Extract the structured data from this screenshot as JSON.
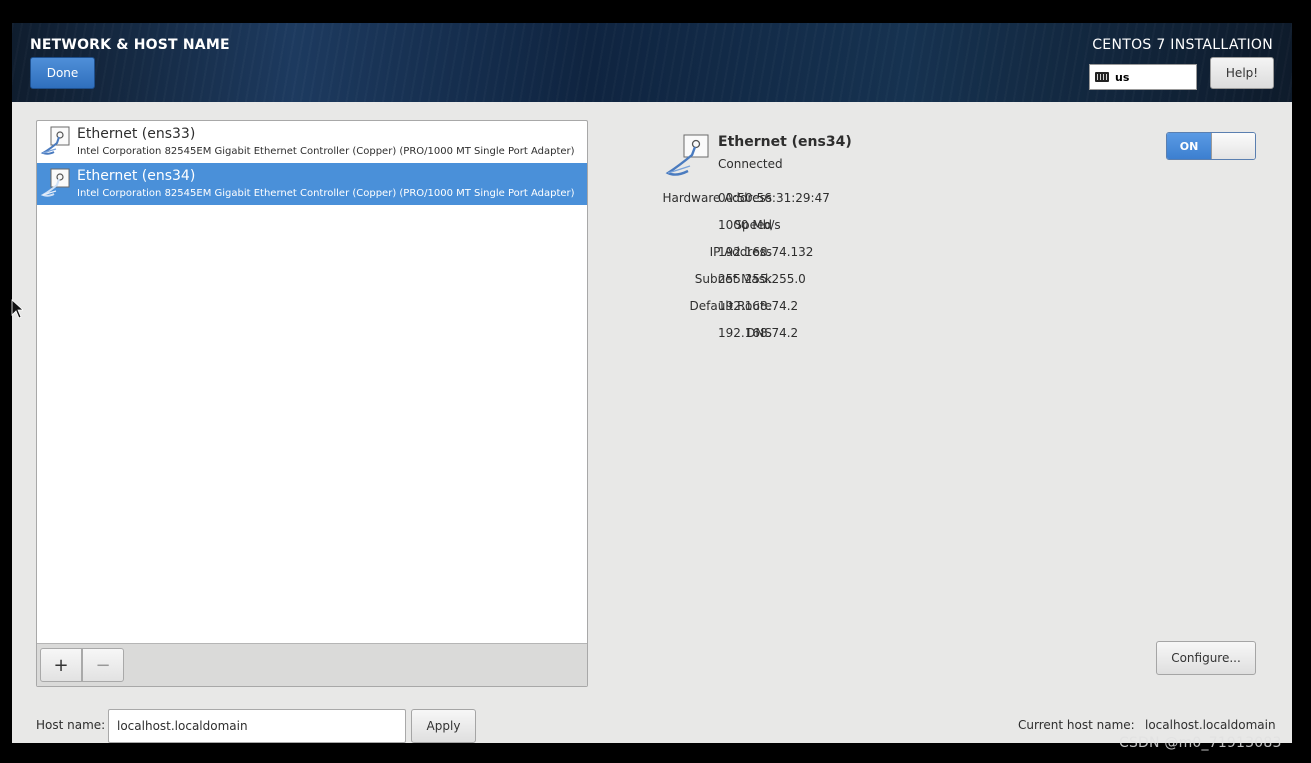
{
  "header": {
    "title": "NETWORK & HOST NAME",
    "done_label": "Done",
    "install_title": "CENTOS 7 INSTALLATION",
    "keyboard_layout": "us",
    "help_label": "Help!"
  },
  "network_list": {
    "items": [
      {
        "name": "Ethernet (ens33)",
        "description": "Intel Corporation 82545EM Gigabit Ethernet Controller (Copper) (PRO/1000 MT Single Port Adapter)",
        "selected": false,
        "icon": "network-wired-icon"
      },
      {
        "name": "Ethernet (ens34)",
        "description": "Intel Corporation 82545EM Gigabit Ethernet Controller (Copper) (PRO/1000 MT Single Port Adapter)",
        "selected": true,
        "icon": "network-wired-icon"
      }
    ],
    "add_label": "+",
    "remove_label": "−"
  },
  "device": {
    "name": "Ethernet (ens34)",
    "status": "Connected",
    "toggle_label": "ON",
    "details": [
      {
        "label": "Hardware Address",
        "value": "00:50:56:31:29:47"
      },
      {
        "label": "Speed",
        "value": "1000 Mb/s"
      },
      {
        "label": "IP Address",
        "value": "192.168.74.132"
      },
      {
        "label": "Subnet Mask",
        "value": "255.255.255.0"
      },
      {
        "label": "Default Route",
        "value": "192.168.74.2"
      },
      {
        "label": "DNS",
        "value": "192.168.74.2"
      }
    ],
    "configure_label": "Configure..."
  },
  "hostname": {
    "label": "Host name:",
    "value": "localhost.localdomain",
    "apply_label": "Apply",
    "current_label": "Current host name:",
    "current_value": "localhost.localdomain"
  },
  "watermark": "CSDN @m0_71913083",
  "colors": {
    "accent": "#4a90d9",
    "background": "#e8e8e7"
  }
}
